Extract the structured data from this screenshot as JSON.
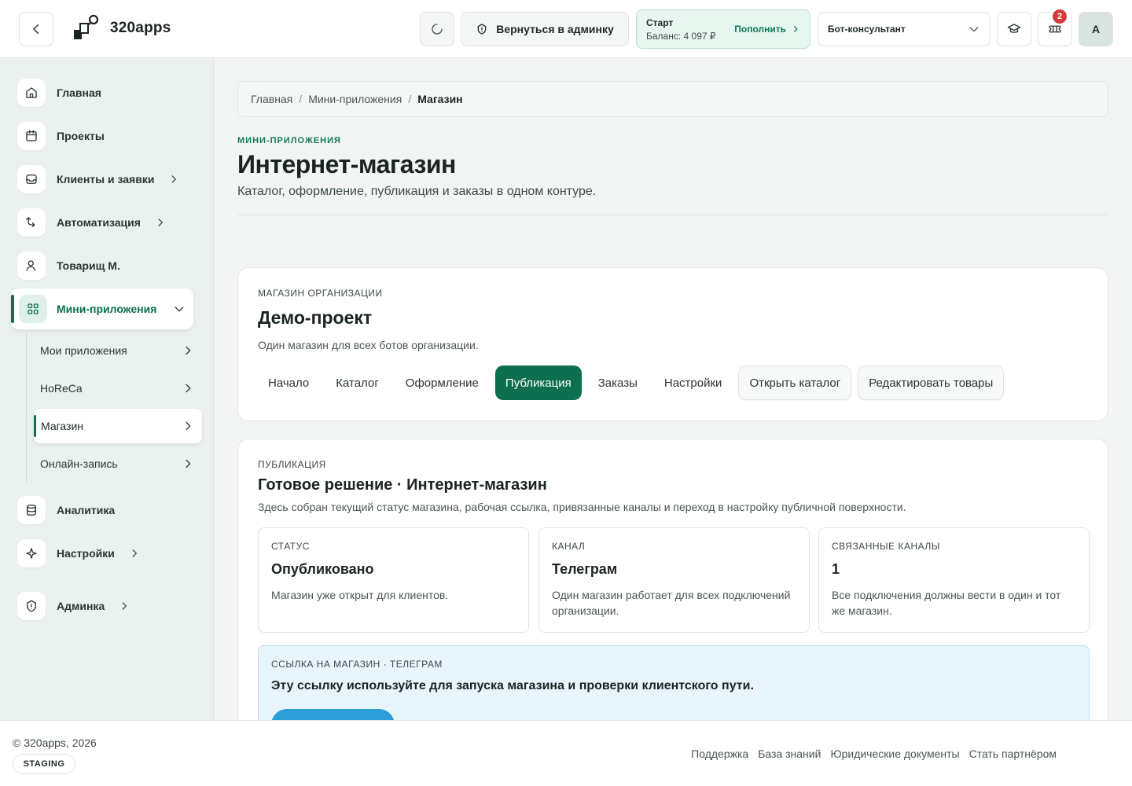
{
  "header": {
    "app_name": "320apps",
    "admin_button": "Вернуться в админку",
    "plan": "Старт",
    "balance": "Баланс: 4 097 ₽",
    "topup": "Пополнить",
    "bot_select": "Бот-консультант",
    "notifications_count": "2",
    "avatar_letter": "A"
  },
  "sidebar": {
    "items": [
      {
        "label": "Главная",
        "icon": "home-icon"
      },
      {
        "label": "Проекты",
        "icon": "calendar-icon"
      },
      {
        "label": "Клиенты и заявки",
        "icon": "inbox-icon"
      },
      {
        "label": "Автоматизация",
        "icon": "automation-icon"
      },
      {
        "label": "Товарищ М.",
        "icon": "user-icon"
      },
      {
        "label": "Мини-приложения",
        "icon": "apps-icon"
      },
      {
        "label": "Аналитика",
        "icon": "database-icon"
      },
      {
        "label": "Настройки",
        "icon": "sparkle-icon"
      },
      {
        "label": "Админка",
        "icon": "shield-icon"
      }
    ],
    "subitems": [
      {
        "label": "Мои приложения"
      },
      {
        "label": "HoReCa"
      },
      {
        "label": "Магазин"
      },
      {
        "label": "Онлайн-запись"
      }
    ]
  },
  "breadcrumb": {
    "home": "Главная",
    "section": "Мини-приложения",
    "current": "Магазин",
    "separator": "/"
  },
  "page": {
    "eyebrow": "МИНИ-ПРИЛОЖЕНИЯ",
    "title": "Интернет-магазин",
    "subtitle": "Каталог, оформление, публикация и заказы в одном контуре."
  },
  "store_card": {
    "eyebrow": "МАГАЗИН ОРГАНИЗАЦИИ",
    "title": "Демо-проект",
    "subtitle": "Один магазин для всех ботов организации.",
    "tabs": [
      {
        "label": "Начало"
      },
      {
        "label": "Каталог"
      },
      {
        "label": "Оформление"
      },
      {
        "label": "Публикация"
      },
      {
        "label": "Заказы"
      },
      {
        "label": "Настройки"
      }
    ],
    "open_catalog": "Открыть каталог",
    "edit_products": "Редактировать товары"
  },
  "publication": {
    "eyebrow": "ПУБЛИКАЦИЯ",
    "title": "Готовое решение · Интернет-магазин",
    "subtitle": "Здесь собран текущий статус магазина, рабочая ссылка, привязанные каналы и переход в настройку публичной поверхности.",
    "stats": [
      {
        "label": "СТАТУС",
        "value": "Опубликовано",
        "desc": "Магазин уже открыт для клиентов."
      },
      {
        "label": "КАНАЛ",
        "value": "Телеграм",
        "desc": "Один магазин работает для всех подключений организации."
      },
      {
        "label": "СВЯЗАННЫЕ КАНАЛЫ",
        "value": "1",
        "desc": "Все подключения должны вести в один и тот же магазин."
      }
    ],
    "link_eyebrow": "ССЫЛКА НА МАГАЗИН · ТЕЛЕГРАМ",
    "link_text": "Эту ссылку используйте для запуска магазина и проверки клиентского пути."
  },
  "footer": {
    "copyright": "© 320apps, 2026",
    "env": "STAGING",
    "links": [
      {
        "label": "Поддержка"
      },
      {
        "label": "База знаний"
      },
      {
        "label": "Юридические документы"
      },
      {
        "label": "Стать партнёром"
      }
    ]
  },
  "colors": {
    "accent": "#0e6e50",
    "accent_text": "#0e7a55",
    "balance_bg": "#e7f6ef",
    "link_bg": "#e8f5fc",
    "link_button": "#2d9fd8",
    "badge": "#d23c3c"
  }
}
